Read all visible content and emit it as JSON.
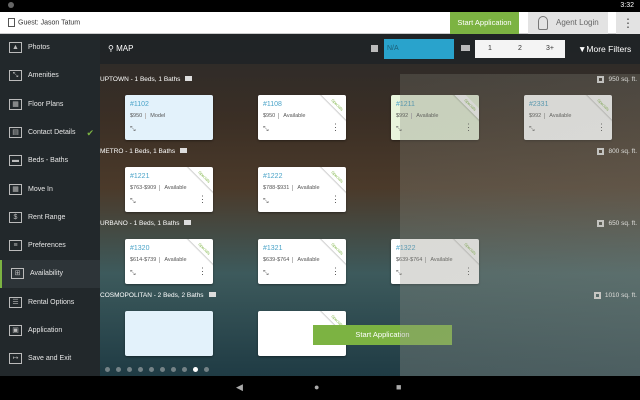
{
  "status": {
    "time": "3:32"
  },
  "header": {
    "guest": "Guest: Jason Tatum",
    "start_application": "Start Application",
    "agent_login": "Agent Login"
  },
  "sidebar": {
    "items": [
      {
        "label": "Photos",
        "icon": "photo-icon"
      },
      {
        "label": "Amenities",
        "icon": "expand-icon"
      },
      {
        "label": "Floor Plans",
        "icon": "floorplan-icon"
      },
      {
        "label": "Contact Details",
        "icon": "contact-card-icon",
        "completed": true
      },
      {
        "label": "Beds - Baths",
        "icon": "bed-icon"
      },
      {
        "label": "Move In",
        "icon": "calendar-icon"
      },
      {
        "label": "Rent Range",
        "icon": "dollar-icon"
      },
      {
        "label": "Preferences",
        "icon": "sliders-icon"
      },
      {
        "label": "Availability",
        "icon": "availability-icon",
        "active": true
      },
      {
        "label": "Rental Options",
        "icon": "list-icon"
      },
      {
        "label": "Application",
        "icon": "application-icon"
      },
      {
        "label": "Save and Exit",
        "icon": "exit-icon"
      }
    ]
  },
  "filters": {
    "map": "MAP",
    "move_in": "N/A",
    "beds": [
      "1",
      "2",
      "3+"
    ],
    "more_filters": "More Filters"
  },
  "sections": [
    {
      "title": "UPTOWN - 1 Beds, 1 Baths",
      "sqft": "950 sq. ft.",
      "units": [
        {
          "num": "#1102",
          "price": "$950",
          "status": "Model",
          "type": "model",
          "ribbon": ""
        },
        {
          "num": "#1108",
          "price": "$950",
          "status": "Available",
          "type": "",
          "ribbon": "Specials"
        },
        {
          "num": "#1211",
          "price": "$992",
          "status": "Available",
          "type": "green",
          "ribbon": "Specials"
        },
        {
          "num": "#2331",
          "price": "$992",
          "status": "Available",
          "type": "",
          "ribbon": "Specials"
        }
      ]
    },
    {
      "title": "METRO - 1 Beds, 1 Baths",
      "sqft": "800 sq. ft.",
      "units": [
        {
          "num": "#1221",
          "price": "$763-$909",
          "status": "Available",
          "type": "",
          "ribbon": "Specials"
        },
        {
          "num": "#1222",
          "price": "$788-$931",
          "status": "Available",
          "type": "",
          "ribbon": "Specials"
        }
      ]
    },
    {
      "title": "URBANO - 1 Beds, 1 Baths",
      "sqft": "650 sq. ft.",
      "units": [
        {
          "num": "#1320",
          "price": "$614-$739",
          "status": "Available",
          "type": "",
          "ribbon": "Specials"
        },
        {
          "num": "#1321",
          "price": "$639-$764",
          "status": "Available",
          "type": "",
          "ribbon": "Specials"
        },
        {
          "num": "#1322",
          "price": "$639-$764",
          "status": "Available",
          "type": "",
          "ribbon": "Specials"
        }
      ]
    },
    {
      "title": "COSMOPOLITAN - 2 Beds, 2 Baths",
      "sqft": "1010 sq. ft.",
      "units": [
        {
          "num": "",
          "price": "",
          "status": "",
          "type": "model",
          "ribbon": ""
        },
        {
          "num": "",
          "price": "",
          "status": "",
          "type": "",
          "ribbon": "Specials"
        }
      ]
    }
  ],
  "start_application_bottom": "Start Application",
  "pager": {
    "count": 10,
    "active": 8
  },
  "colors": {
    "accent": "#7cb342",
    "blue": "#29a3cc"
  }
}
